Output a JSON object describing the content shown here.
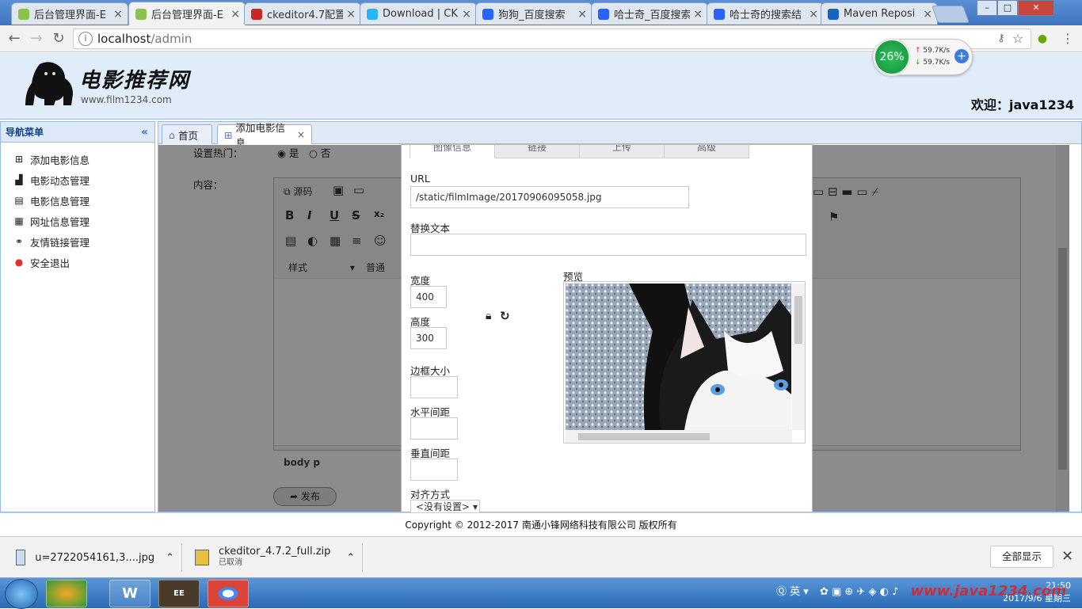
{
  "browser": {
    "tabs": [
      {
        "label": "后台管理界面-E",
        "color": "#8bc34a"
      },
      {
        "label": "后台管理界面-E",
        "color": "#8bc34a",
        "active": true
      },
      {
        "label": "ckeditor4.7配置",
        "color": "#c62828"
      },
      {
        "label": "Download | CK",
        "color": "#29b6f6"
      },
      {
        "label": "狗狗_百度搜索",
        "color": "#2962ff"
      },
      {
        "label": "哈士奇_百度搜索",
        "color": "#2962ff"
      },
      {
        "label": "哈士奇的搜索结",
        "color": "#2962ff"
      },
      {
        "label": "Maven Reposi",
        "color": "#1565c0"
      }
    ],
    "url_host": "localhost",
    "url_path": "/admin",
    "speed": {
      "percent": "26%",
      "up": "59.7K/s",
      "down": "59.7K/s"
    }
  },
  "header": {
    "logo_title": "电影推荐网",
    "logo_sub": "www.film1234.com",
    "welcome": "欢迎：java1234"
  },
  "sidebar": {
    "title": "导航菜单",
    "collapse": "«",
    "items": [
      {
        "label": "添加电影信息",
        "icon": "add-icon"
      },
      {
        "label": "电影动态管理",
        "icon": "chart-icon"
      },
      {
        "label": "电影信息管理",
        "icon": "film-icon"
      },
      {
        "label": "网址信息管理",
        "icon": "grid-icon"
      },
      {
        "label": "友情链接管理",
        "icon": "link-icon"
      },
      {
        "label": "安全退出",
        "icon": "exit-icon"
      }
    ]
  },
  "main_tabs": [
    {
      "label": "首页",
      "icon": "home-icon"
    },
    {
      "label": "添加电影信息",
      "icon": "add-icon",
      "closable": true
    }
  ],
  "form": {
    "hot_label": "设置热门：",
    "hot_yes": "是",
    "hot_no": "否",
    "content_label": "内容：",
    "toolbar": {
      "source": "源码",
      "style": "样式",
      "format": "普通"
    },
    "path": "body  p",
    "publish": "发布"
  },
  "dialog": {
    "tabs": [
      "图像信息",
      "链接",
      "上传",
      "高级"
    ],
    "url_label": "URL",
    "url_value": "/static/filmImage/20170906095058.jpg",
    "alt_label": "替换文本",
    "alt_value": "",
    "width_label": "宽度",
    "width_value": "400",
    "height_label": "高度",
    "height_value": "300",
    "border_label": "边框大小",
    "hspace_label": "水平间距",
    "vspace_label": "垂直间距",
    "align_label": "对齐方式",
    "align_value": "<没有设置>",
    "preview_label": "预览"
  },
  "footer": {
    "copyright": "Copyright © 2012-2017 南通小锋网络科技有限公司 版权所有"
  },
  "downloads": {
    "items": [
      {
        "name": "u=2722054161,3....jpg",
        "status": ""
      },
      {
        "name": "ckeditor_4.7.2_full.zip",
        "status": "已取消"
      }
    ],
    "show_all": "全部显示"
  },
  "taskbar": {
    "ime": "英",
    "time": "21:50",
    "date": "2017/9/6 星期三",
    "watermark": "www.java1234.com"
  }
}
